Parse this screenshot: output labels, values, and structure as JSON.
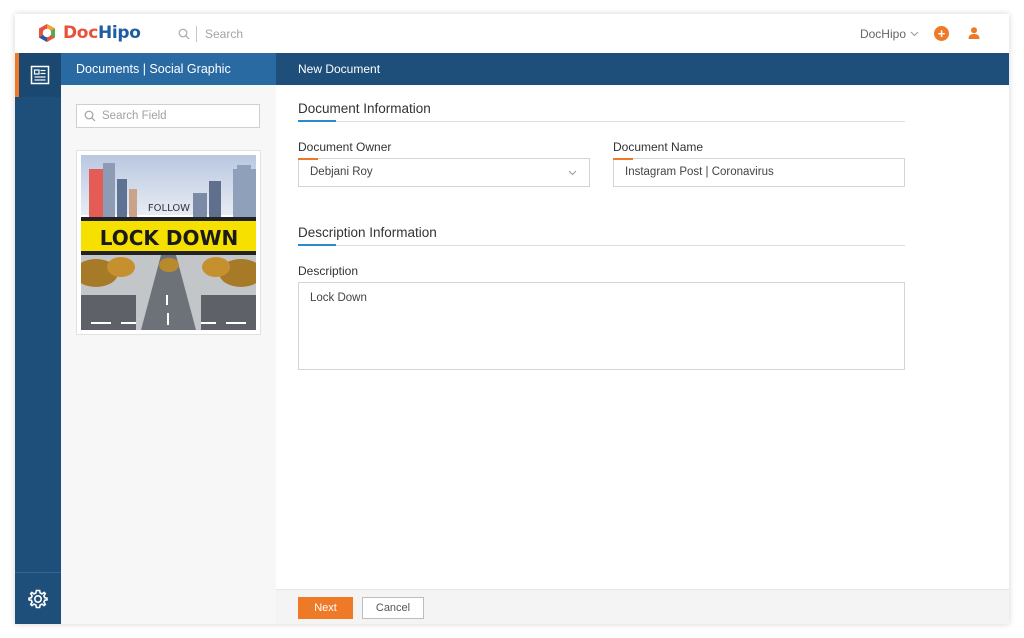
{
  "app": {
    "brand_part1": "Doc",
    "brand_part2": "Hipo",
    "search_placeholder": "Search",
    "user_menu_label": "DocHipo",
    "plus_label": "+"
  },
  "colors": {
    "accent": "#ee7a27",
    "nav": "#1d4f7a",
    "panel_header": "#2a6aa3"
  },
  "icons": [
    "logo-icon",
    "search-icon",
    "chevron-down-icon",
    "plus-icon",
    "user-icon",
    "document-icon",
    "gear-icon"
  ],
  "left_panel": {
    "header": "Documents | Social Graphic",
    "search_placeholder": "Search Field",
    "template_thumbnail": {
      "small_text": "FOLLOW",
      "headline": "LOCK DOWN"
    }
  },
  "main": {
    "header": "New Document",
    "document_information": {
      "title": "Document Information",
      "owner_label": "Document Owner",
      "owner_value": "Debjani Roy",
      "name_label": "Document Name",
      "name_value": "Instagram Post | Coronavirus"
    },
    "description_information": {
      "title": "Description Information",
      "description_label": "Description",
      "description_value": "Lock Down"
    }
  },
  "footer": {
    "next_label": "Next",
    "cancel_label": "Cancel"
  }
}
